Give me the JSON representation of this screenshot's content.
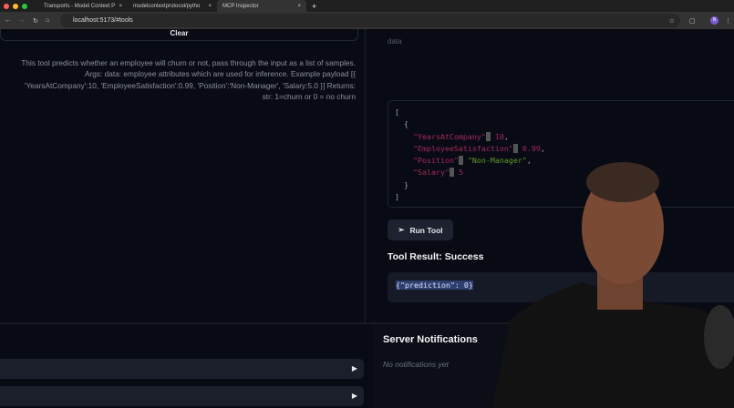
{
  "browser": {
    "tabs": [
      {
        "title": "Transports - Model Context P"
      },
      {
        "title": "modelcontextprotocol/pytho"
      },
      {
        "title": "MCP Inspector"
      }
    ],
    "url": "localhost:5173/#tools",
    "profile": "N"
  },
  "left": {
    "clear_label": "Clear",
    "description": "This tool predicts whether an employee will churn or not, pass through the input as a list of samples. Args: data: employee attributes which are used for inference. Example payload [{ 'YearsAtCompany':10, 'EmployeeSatisfaction':0.99, 'Position':'Non-Manager', 'Salary:5.0 }] Returns: str: 1=churn or 0 = no churn"
  },
  "right": {
    "param_label": "data",
    "json": {
      "k1": "\"YearsAtCompany\"",
      "v1": "10",
      "k2": "\"EmployeeSatisfaction\"",
      "v2": "0.99",
      "k3": "\"Position\"",
      "v3": "\"Non-Manager\"",
      "k4": "\"Salary\"",
      "v4": "5"
    },
    "run_label": "Run Tool",
    "result_title": "Tool Result: Success",
    "result": "{\"prediction\": 0}"
  },
  "notifications": {
    "title": "Server Notifications",
    "empty": "No notifications yet"
  },
  "colors": {
    "bg": "#090b14",
    "key": "#a3285a",
    "string": "#5d9a2b"
  }
}
